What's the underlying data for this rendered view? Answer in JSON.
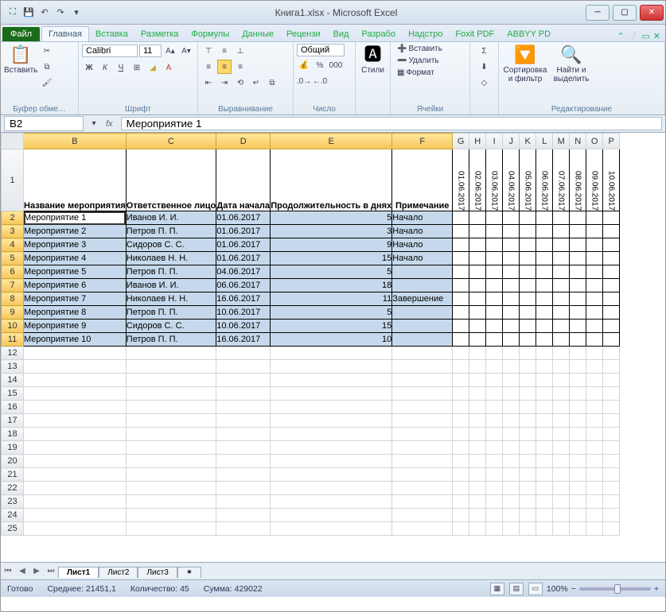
{
  "title": "Книга1.xlsx - Microsoft Excel",
  "tabs": {
    "file": "Файл",
    "home": "Главная",
    "insert": "Вставка",
    "layout": "Разметка",
    "formulas": "Формулы",
    "data": "Данные",
    "review": "Рецензи",
    "view": "Вид",
    "dev": "Разрабо",
    "addins": "Надстро",
    "foxit": "Foxit PDF",
    "abbyy": "ABBYY PD"
  },
  "ribbon": {
    "paste": "Вставить",
    "clipboard": "Буфер обме…",
    "font_name": "Calibri",
    "font_size": "11",
    "font_group": "Шрифт",
    "align_group": "Выравнивание",
    "number_format": "Общий",
    "number_group": "Число",
    "styles": "Стили",
    "insert_btn": "Вставить",
    "delete_btn": "Удалить",
    "format_btn": "Формат",
    "cells_group": "Ячейки",
    "sort": "Сортировка и фильтр",
    "find": "Найти и выделить",
    "editing_group": "Редактирование"
  },
  "namebox": "B2",
  "formula": "Мероприятие 1",
  "fx": "fx",
  "columns": [
    "B",
    "C",
    "D",
    "E",
    "F",
    "G",
    "H",
    "I",
    "J",
    "K",
    "L",
    "M",
    "N",
    "O",
    "P"
  ],
  "headers": {
    "b": "Название мероприятия",
    "c": "Ответственное лицо",
    "d": "Дата начала",
    "e": "Продолжительность в днях",
    "f": "Примечание"
  },
  "dates": [
    "01.06.2017",
    "02.06.2017",
    "03.06.2017",
    "04.06.2017",
    "05.06.2017",
    "06.06.2017",
    "07.06.2017",
    "08.06.2017",
    "09.06.2017",
    "10.06.2017"
  ],
  "rows": [
    {
      "n": "Мероприятие 1",
      "p": "Иванов И. И.",
      "d": "01.06.2017",
      "dur": "5",
      "note": "Начало"
    },
    {
      "n": "Мероприятие 2",
      "p": "Петров П. П.",
      "d": "01.06.2017",
      "dur": "3",
      "note": "Начало"
    },
    {
      "n": "Мероприятие 3",
      "p": "Сидоров С. С.",
      "d": "01.06.2017",
      "dur": "9",
      "note": "Начало"
    },
    {
      "n": "Мероприятие 4",
      "p": "Николаев Н. Н.",
      "d": "01.06.2017",
      "dur": "15",
      "note": "Начало"
    },
    {
      "n": "Мероприятие 5",
      "p": "Петров П. П.",
      "d": "04.06.2017",
      "dur": "5",
      "note": ""
    },
    {
      "n": "Мероприятие 6",
      "p": "Иванов И. И.",
      "d": "06.06.2017",
      "dur": "18",
      "note": ""
    },
    {
      "n": "Мероприятие 7",
      "p": "Николаев Н. Н.",
      "d": "16.06.2017",
      "dur": "11",
      "note": "Завершение"
    },
    {
      "n": "Мероприятие 8",
      "p": "Петров П. П.",
      "d": "10.06.2017",
      "dur": "5",
      "note": ""
    },
    {
      "n": "Мероприятие 9",
      "p": "Сидоров С. С.",
      "d": "10.06.2017",
      "dur": "15",
      "note": ""
    },
    {
      "n": "Мероприятие 10",
      "p": "Петров П. П.",
      "d": "16.06.2017",
      "dur": "10",
      "note": ""
    }
  ],
  "sheets": {
    "s1": "Лист1",
    "s2": "Лист2",
    "s3": "Лист3"
  },
  "status": {
    "ready": "Готово",
    "avg": "Среднее: 21451,1",
    "count": "Количество: 45",
    "sum": "Сумма: 429022",
    "zoom": "100%"
  }
}
